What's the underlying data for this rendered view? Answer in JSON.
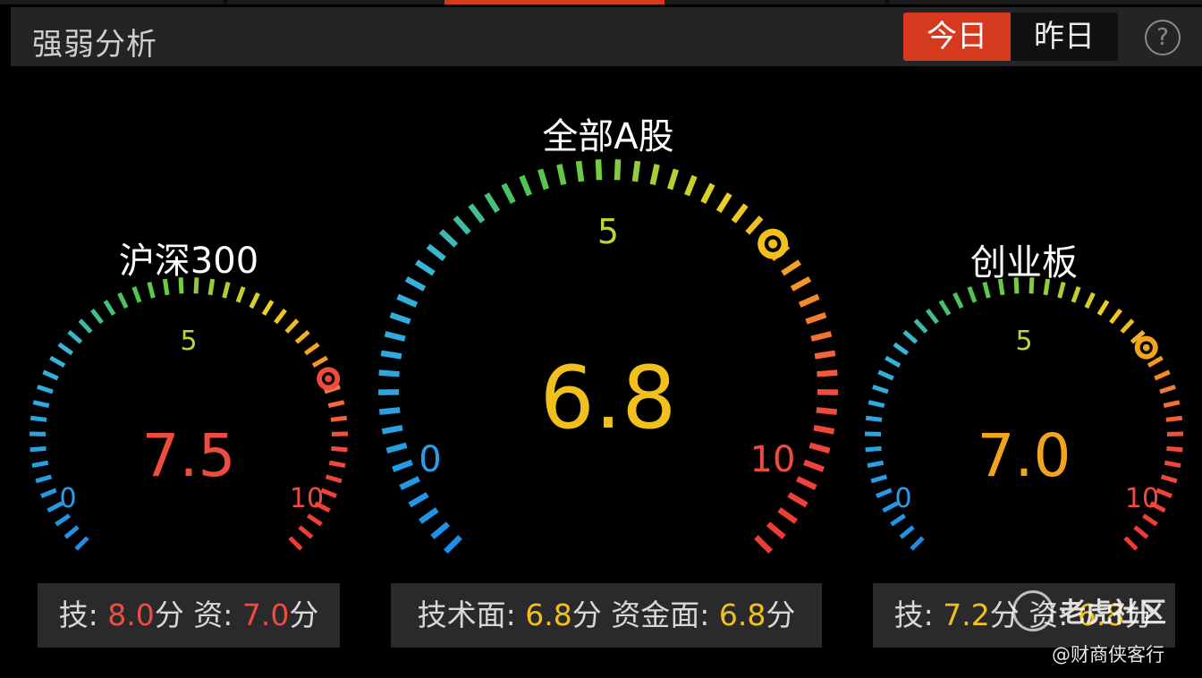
{
  "header": {
    "title": "强弱分析",
    "tabs": [
      {
        "label": "今日",
        "active": true
      },
      {
        "label": "昨日",
        "active": false
      }
    ],
    "help_label": "?"
  },
  "colors": {
    "accent": "#d63a1e",
    "red": "#f04b3f",
    "yellow": "#f2c01c",
    "orange": "#f2a51c",
    "green": "#4cc64f",
    "blue": "#2a9ee8",
    "panel": "#2a2a2c"
  },
  "gauges": [
    {
      "id": "hs300",
      "title": "沪深300",
      "value": 7.5,
      "value_text": "7.5",
      "value_color": "#f04b3f",
      "marker_color": "#f04b3f",
      "min_label": "0",
      "mid_label": "5",
      "max_label": "10"
    },
    {
      "id": "all-a",
      "title": "全部A股",
      "value": 6.8,
      "value_text": "6.8",
      "value_color": "#f2c01c",
      "marker_color": "#f2c01c",
      "min_label": "0",
      "mid_label": "5",
      "max_label": "10"
    },
    {
      "id": "chinext",
      "title": "创业板",
      "value": 7.0,
      "value_text": "7.0",
      "value_color": "#f2a51c",
      "marker_color": "#f2a51c",
      "min_label": "0",
      "mid_label": "5",
      "max_label": "10"
    }
  ],
  "footers": {
    "left": {
      "tech_label": "技:",
      "tech_value": "8.0",
      "unit": "分",
      "fund_label": "资:",
      "fund_value": "7.0"
    },
    "mid": {
      "tech_label": "技术面:",
      "tech_value": "6.8",
      "unit": "分",
      "fund_label": "资金面:",
      "fund_value": "6.8"
    },
    "right": {
      "tech_label": "技:",
      "tech_value": "7.2",
      "unit": "分",
      "fund_label": "资:",
      "fund_value": "6.8"
    }
  },
  "watermark": {
    "brand": "老虎社区",
    "credit": "@财商侠客行"
  }
}
